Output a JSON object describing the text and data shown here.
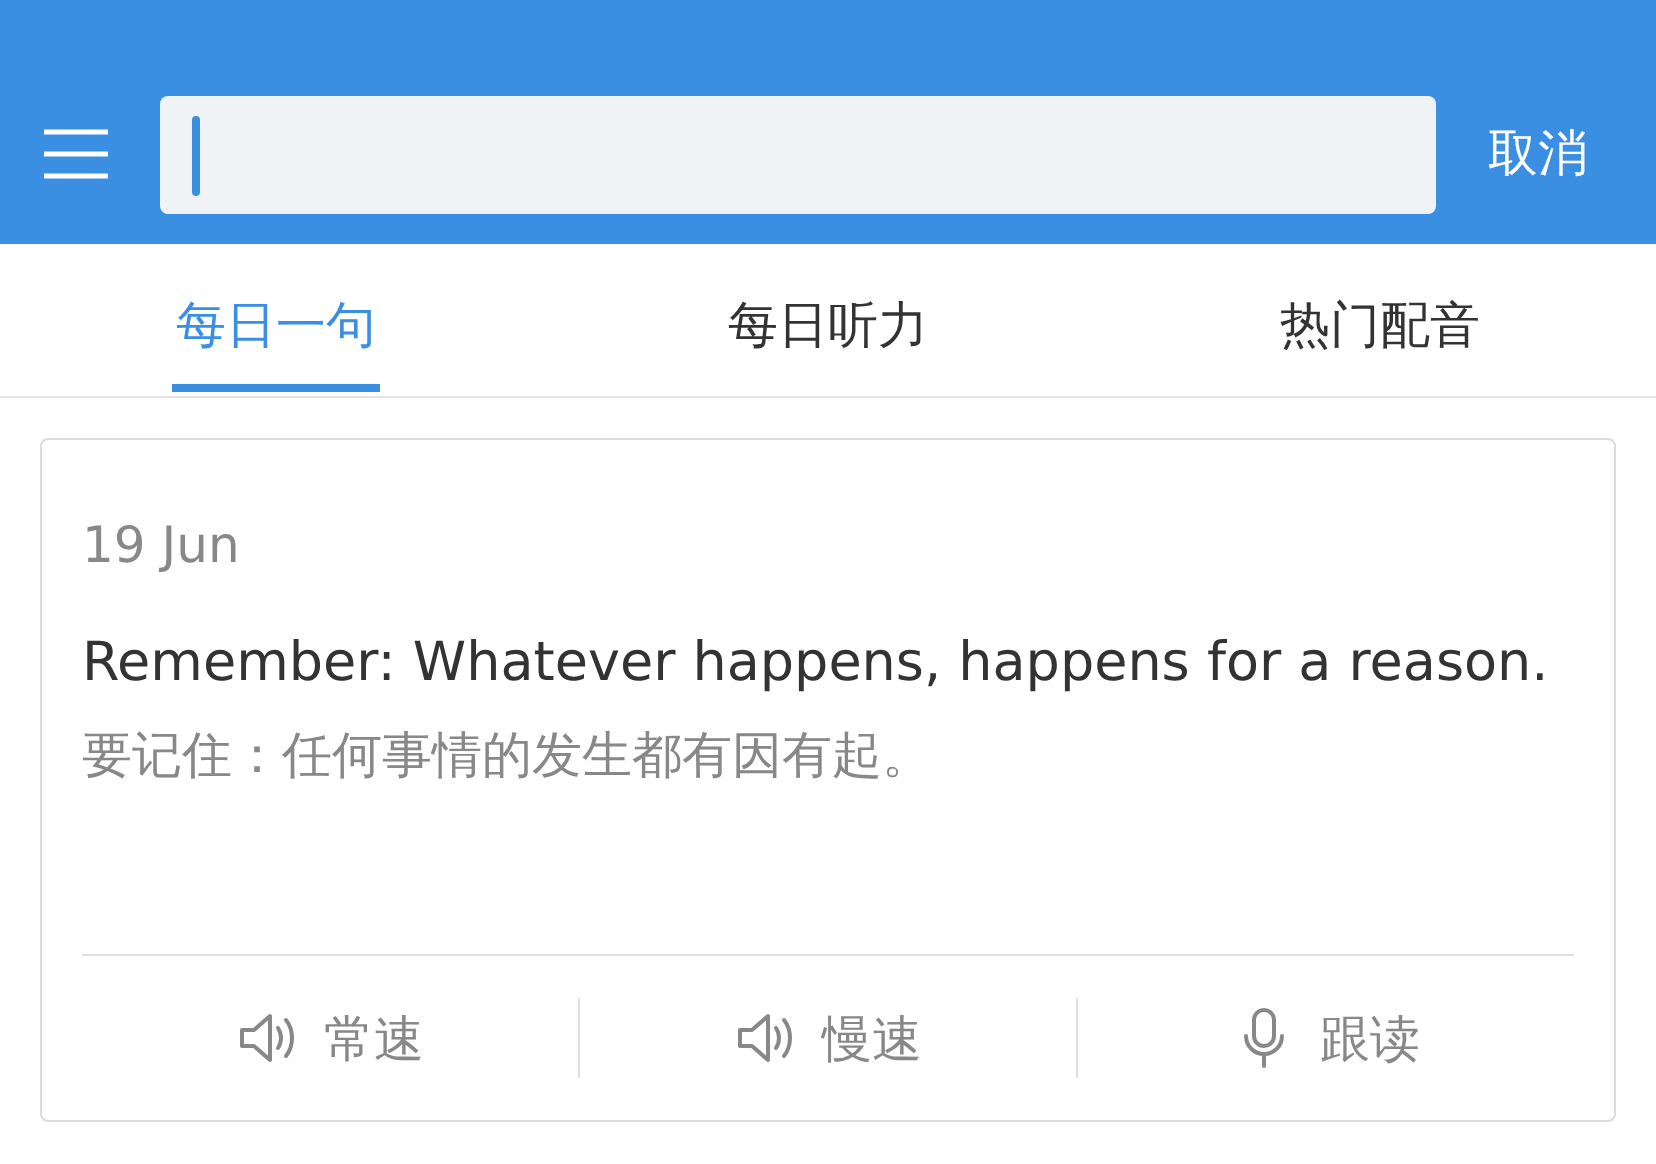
{
  "header": {
    "cancel": "取消"
  },
  "tabs": [
    {
      "label": "每日一句",
      "selected": true
    },
    {
      "label": "每日听力",
      "selected": false
    },
    {
      "label": "热门配音",
      "selected": false
    }
  ],
  "card": {
    "date": "19 Jun",
    "english": "Remember: Whatever happens, happens for a reason.",
    "chinese": "要记住：任何事情的发生都有因有起。",
    "actions": [
      {
        "kind": "speaker",
        "label": "常速"
      },
      {
        "kind": "speaker",
        "label": "慢速"
      },
      {
        "kind": "mic",
        "label": "跟读"
      }
    ]
  }
}
